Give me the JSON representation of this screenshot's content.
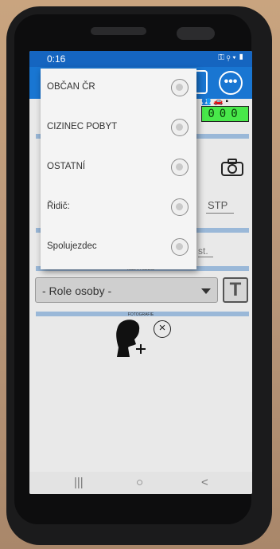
{
  "status_bar": {
    "time": "0:16",
    "right_icons": "⚿ ⚲ ▾ ▮"
  },
  "appbar": {
    "more_icon": "•••"
  },
  "header": {
    "icons": "👥 🚗 ▪",
    "counter": "000"
  },
  "dropdown": {
    "items": [
      {
        "label": "OBČAN ČR"
      },
      {
        "label": "CIZINEC POBYT"
      },
      {
        "label": "OSTATNÍ"
      },
      {
        "label": "Řidič:"
      },
      {
        "label": "Spolujezdec"
      }
    ]
  },
  "form": {
    "stp_label": "STP",
    "st_label": "st.",
    "role_select": "- Role osoby -",
    "t_button": "T",
    "section_role": "ROLE V PODNIKU",
    "section_photo": "FOTOGRAFIE",
    "clear_icon": "×"
  },
  "navbar": {
    "recent": "|||",
    "home": "○",
    "back": "<"
  },
  "colors": {
    "status_bar": "#1565c0",
    "app_bar": "#1976d2",
    "counter_bg": "#48e84a",
    "section_bar": "#9ab8d8"
  }
}
